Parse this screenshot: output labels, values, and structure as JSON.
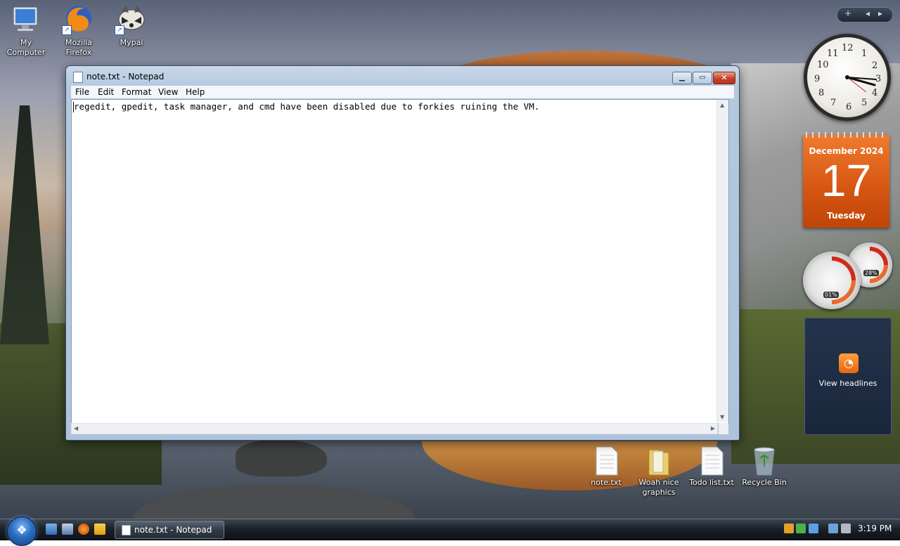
{
  "desktop": {
    "icons": [
      {
        "label": "My\nComputer",
        "icon": "computer-icon"
      },
      {
        "label": "Mozilla\nFirefox",
        "icon": "firefox-icon"
      },
      {
        "label": "Mypal",
        "icon": "mypal-raccoon-icon"
      },
      {
        "label": "note.txt",
        "icon": "text-file-icon"
      },
      {
        "label": "Woah nice\ngraphics",
        "icon": "folder-icon"
      },
      {
        "label": "Todo list.txt",
        "icon": "text-file-icon"
      },
      {
        "label": "Recycle Bin",
        "icon": "recycle-bin-icon"
      }
    ]
  },
  "notepad": {
    "title": "note.txt - Notepad",
    "menu": [
      "File",
      "Edit",
      "Format",
      "View",
      "Help"
    ],
    "content": "regedit, gpedit, task manager, and cmd have been disabled due to forkies ruining the VM."
  },
  "gadgets": {
    "clock": {
      "numbers": [
        "12",
        "1",
        "2",
        "3",
        "4",
        "5",
        "6",
        "7",
        "8",
        "9",
        "10",
        "11"
      ],
      "time": "3:19"
    },
    "calendar": {
      "month": "December 2024",
      "day": "17",
      "weekday": "Tuesday"
    },
    "cpu_meter": {
      "cpu": "01%",
      "memory": "28%"
    },
    "feeds": {
      "label": "View headlines"
    },
    "sidebar_controls": {
      "add": "+",
      "prev": "◂",
      "next": "▸"
    }
  },
  "taskbar": {
    "start_icon": "windows-orb-icon",
    "quick_launch": [
      "show-desktop-icon",
      "switch-windows-icon",
      "firefox-icon",
      "media-player-icon"
    ],
    "task_button": "note.txt - Notepad",
    "clock": "3:19 PM"
  },
  "colors": {
    "close_button": "#c7402a",
    "calendar": "#e0621b",
    "taskbar": "#1b2128"
  }
}
